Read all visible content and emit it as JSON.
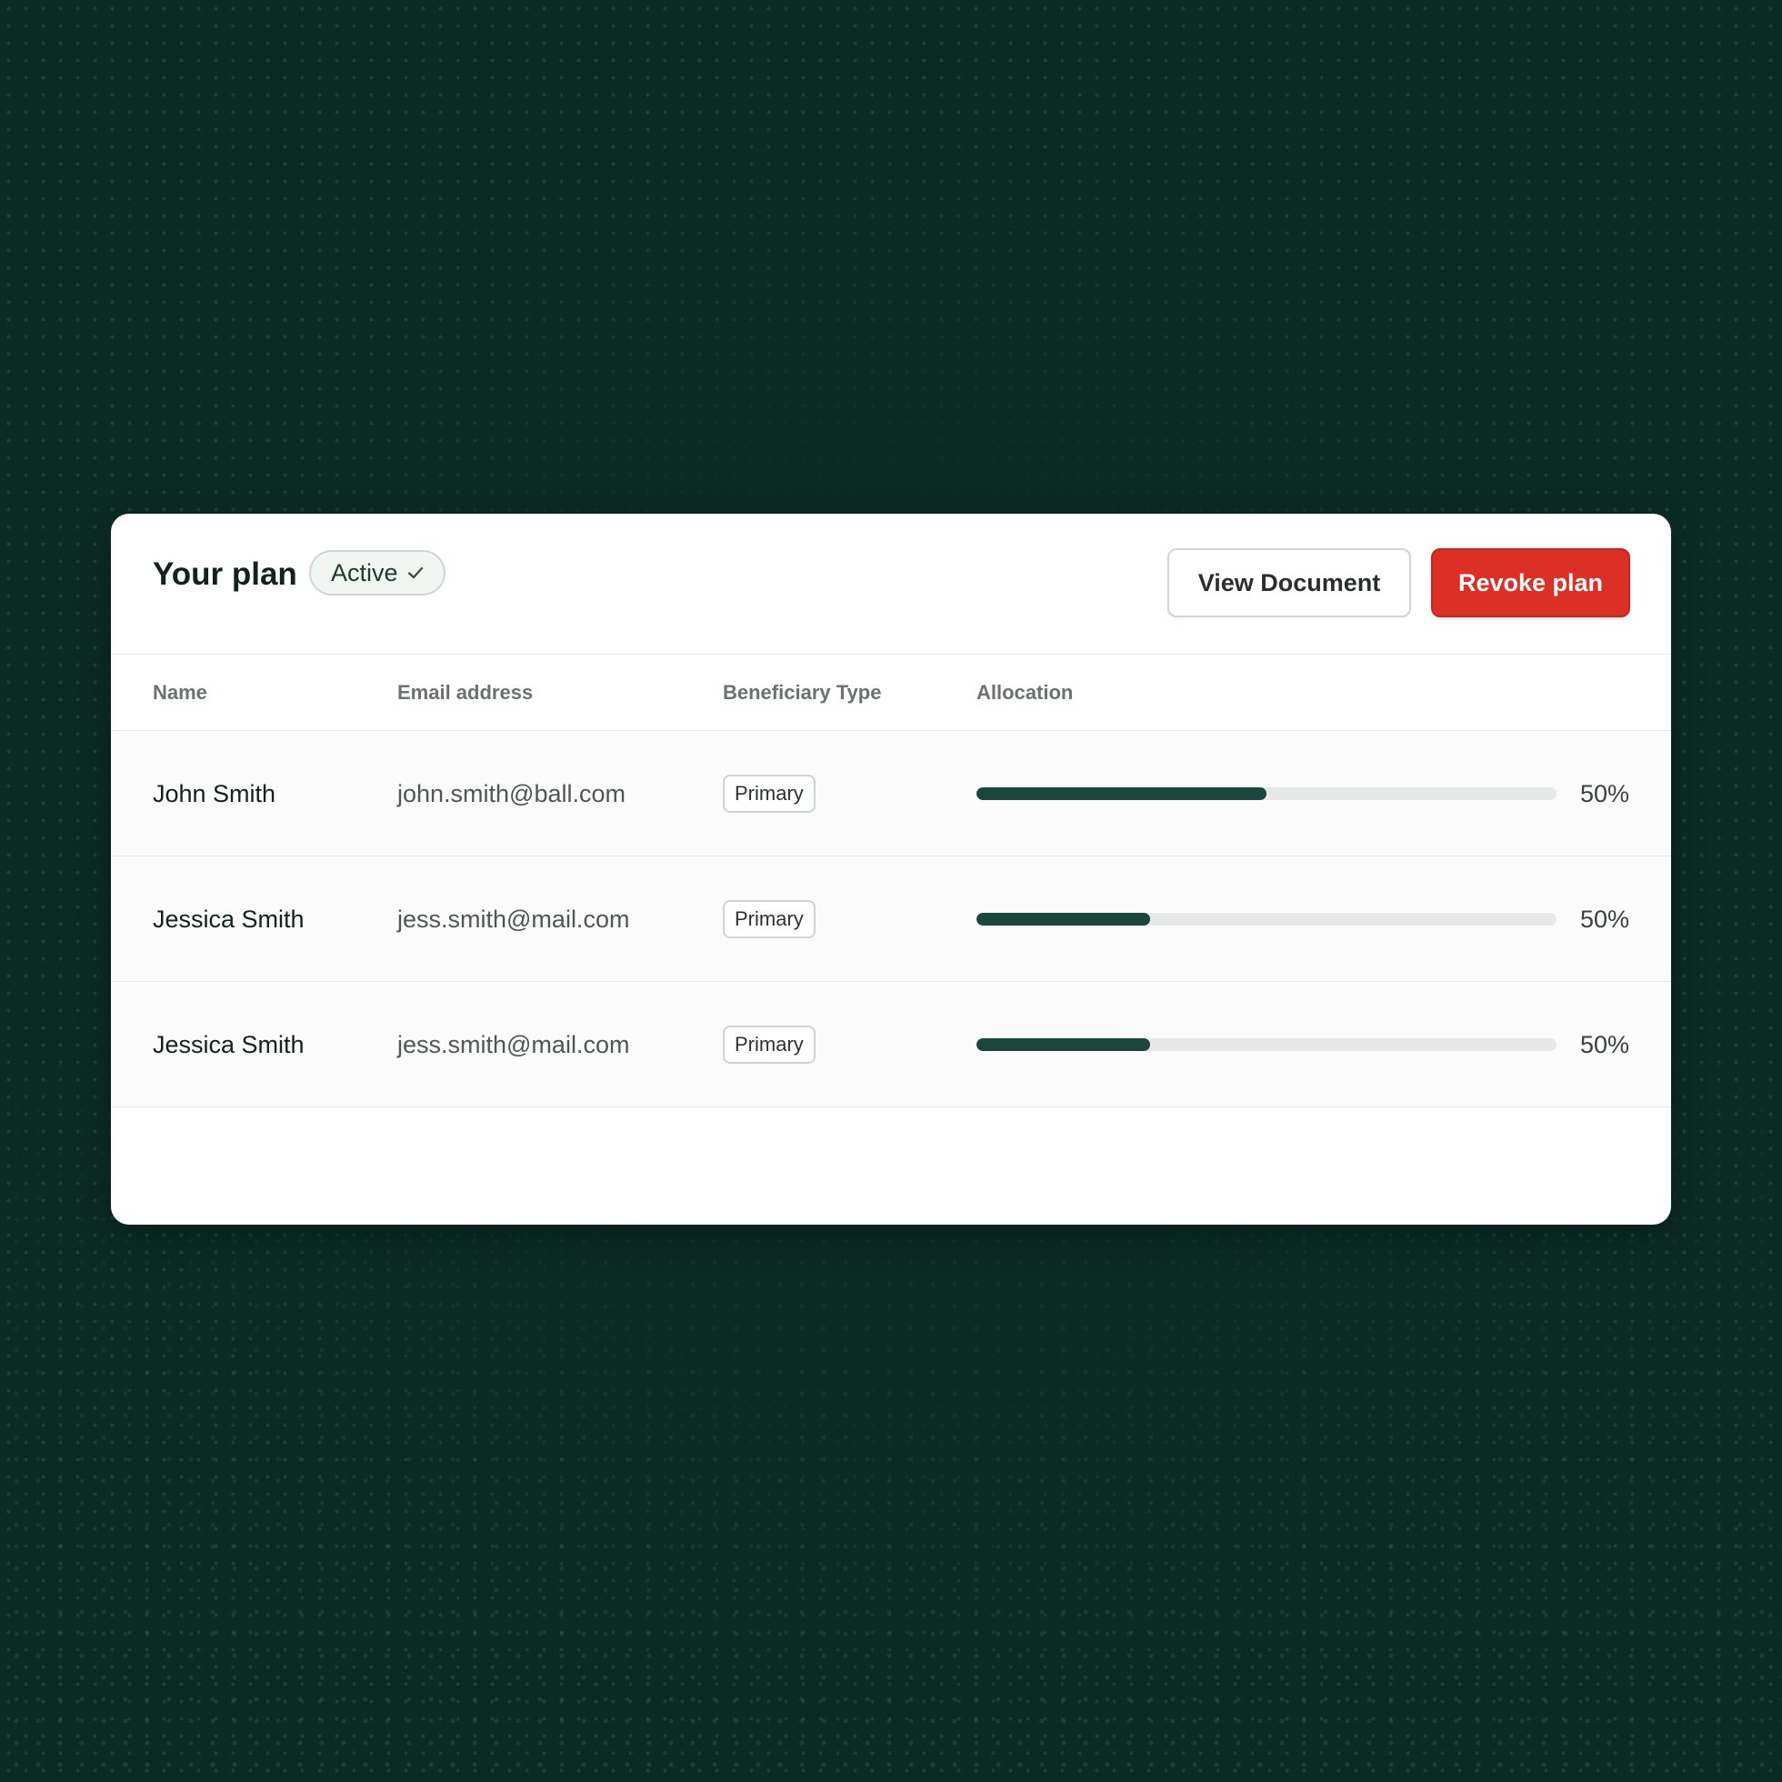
{
  "colors": {
    "background": "#0b2a24",
    "accent": "#1b463b",
    "danger": "#dc2f26"
  },
  "header": {
    "title": "Your plan",
    "status": "Active",
    "status_icon": "check-icon",
    "view_document_label": "View Document",
    "revoke_label": "Revoke plan"
  },
  "table": {
    "columns": [
      "Name",
      "Email address",
      "Beneficiary Type",
      "Allocation"
    ],
    "rows": [
      {
        "name": "John Smith",
        "email": "john.smith@ball.com",
        "type": "Primary",
        "allocation_label": "50%",
        "bar_fill": 0.5
      },
      {
        "name": "Jessica Smith",
        "email": "jess.smith@mail.com",
        "type": "Primary",
        "allocation_label": "50%",
        "bar_fill": 0.3
      },
      {
        "name": "Jessica Smith",
        "email": "jess.smith@mail.com",
        "type": "Primary",
        "allocation_label": "50%",
        "bar_fill": 0.3
      }
    ]
  }
}
